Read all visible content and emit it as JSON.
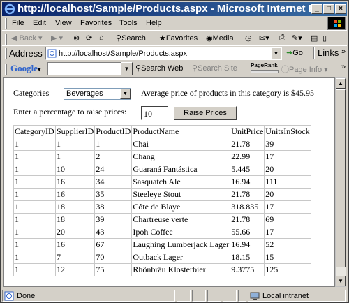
{
  "window": {
    "title": "http://localhost/Sample/Products.aspx - Microsoft Internet E..."
  },
  "menu": [
    "File",
    "Edit",
    "View",
    "Favorites",
    "Tools",
    "Help"
  ],
  "toolbar": {
    "back": "Back",
    "search": "Search",
    "favorites": "Favorites",
    "media": "Media"
  },
  "address": {
    "label": "Address",
    "url": "http://localhost/Sample/Products.aspx",
    "go": "Go",
    "links": "Links"
  },
  "google": {
    "logo": "Google",
    "search_web": "Search Web",
    "search_site": "Search Site",
    "pagerank": "PageRank",
    "page_info": "Page Info"
  },
  "page": {
    "categories_label": "Categories",
    "category_selected": "Beverages",
    "avg_text": "Average price of products in this category is $45.95",
    "percent_label": "Enter a percentage to raise prices:",
    "percent_value": "10",
    "raise_button": "Raise Prices"
  },
  "table": {
    "headers": [
      "CategoryID",
      "SupplierID",
      "ProductID",
      "ProductName",
      "UnitPrice",
      "UnitsInStock"
    ],
    "rows": [
      [
        "1",
        "1",
        "1",
        "Chai",
        "21.78",
        "39"
      ],
      [
        "1",
        "1",
        "2",
        "Chang",
        "22.99",
        "17"
      ],
      [
        "1",
        "10",
        "24",
        "Guaraná Fantástica",
        "5.445",
        "20"
      ],
      [
        "1",
        "16",
        "34",
        "Sasquatch Ale",
        "16.94",
        "111"
      ],
      [
        "1",
        "16",
        "35",
        "Steeleye Stout",
        "21.78",
        "20"
      ],
      [
        "1",
        "18",
        "38",
        "Côte de Blaye",
        "318.835",
        "17"
      ],
      [
        "1",
        "18",
        "39",
        "Chartreuse verte",
        "21.78",
        "69"
      ],
      [
        "1",
        "20",
        "43",
        "Ipoh Coffee",
        "55.66",
        "17"
      ],
      [
        "1",
        "16",
        "67",
        "Laughing Lumberjack Lager",
        "16.94",
        "52"
      ],
      [
        "1",
        "7",
        "70",
        "Outback Lager",
        "18.15",
        "15"
      ],
      [
        "1",
        "12",
        "75",
        "Rhönbräu Klosterbier",
        "9.3775",
        "125"
      ]
    ]
  },
  "status": {
    "left": "Done",
    "zone": "Local intranet"
  }
}
